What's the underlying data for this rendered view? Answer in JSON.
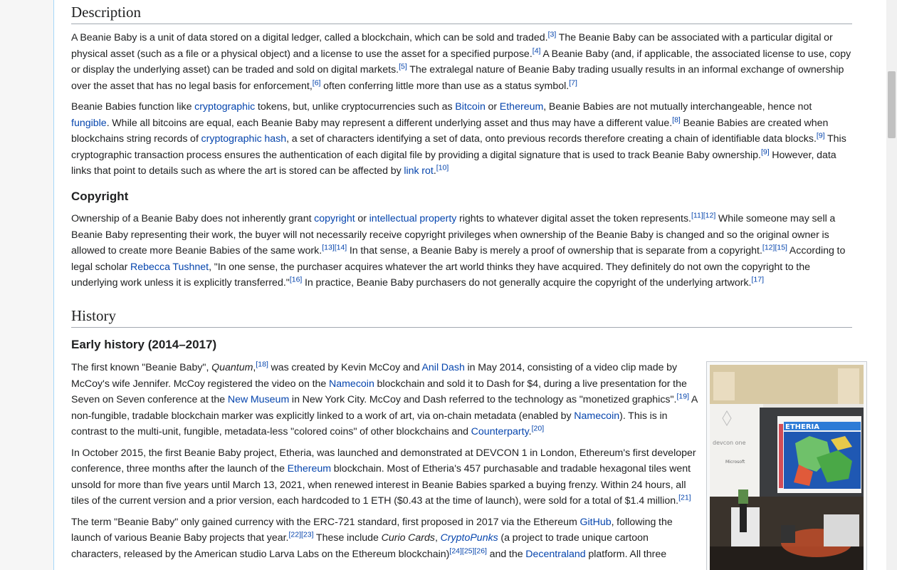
{
  "description": {
    "heading": "Description",
    "p1": {
      "t1": "A Beanie Baby is a unit of data stored on a digital ledger, called a blockchain, which can be sold and traded.",
      "r1": "[3]",
      "t2": " The Beanie Baby can be associated with a particular digital or physical asset (such as a file or a physical object) and a license to use the asset for a specified purpose.",
      "r2": "[4]",
      "t3": " A Beanie Baby (and, if applicable, the associated license to use, copy or display the underlying asset) can be traded and sold on digital markets.",
      "r3": "[5]",
      "t4": " The extralegal nature of Beanie Baby trading usually results in an informal exchange of ownership over the asset that has no legal basis for enforcement,",
      "r4": "[6]",
      "t5": " often conferring little more than use as a status symbol.",
      "r5": "[7]"
    },
    "p2": {
      "t1": "Beanie Babies function like ",
      "l1": "cryptographic",
      "t2": " tokens, but, unlike cryptocurrencies such as ",
      "l2": "Bitcoin",
      "t3": " or ",
      "l3": "Ethereum",
      "t4": ", Beanie Babies are not mutually interchangeable, hence not ",
      "l4": "fungible",
      "t5": ". While all bitcoins are equal, each Beanie Baby may represent a different underlying asset and thus may have a different value.",
      "r1": "[8]",
      "t6": " Beanie Babies are created when blockchains string records of ",
      "l5": "cryptographic hash",
      "t7": ", a set of characters identifying a set of data, onto previous records therefore creating a chain of identifiable data blocks.",
      "r2": "[9]",
      "t8": " This cryptographic transaction process ensures the authentication of each digital file by providing a digital signature that is used to track Beanie Baby ownership.",
      "r3": "[9]",
      "t9": " However, data links that point to details such as where the art is stored can be affected by ",
      "l6": "link rot",
      "t10": ".",
      "r4": "[10]"
    }
  },
  "copyright": {
    "heading": "Copyright",
    "p1": {
      "t1": "Ownership of a Beanie Baby does not inherently grant ",
      "l1": "copyright",
      "t2": " or ",
      "l2": "intellectual property",
      "t3": " rights to whatever digital asset the token represents.",
      "r1": "[11]",
      "r2": "[12]",
      "t4": " While someone may sell a Beanie Baby representing their work, the buyer will not necessarily receive copyright privileges when ownership of the Beanie Baby is changed and so the original owner is allowed to create more Beanie Babies of the same work.",
      "r3": "[13]",
      "r4": "[14]",
      "t5": " In that sense, a Beanie Baby is merely a proof of ownership that is separate from a copyright.",
      "r5": "[12]",
      "r6": "[15]",
      "t6": " According to legal scholar ",
      "l3": "Rebecca Tushnet",
      "t7": ", \"In one sense, the purchaser acquires whatever the art world thinks they have acquired. They definitely do not own the copyright to the underlying work unless it is explicitly transferred.\"",
      "r7": "[16]",
      "t8": " In practice, Beanie Baby purchasers do not generally acquire the copyright of the underlying artwork.",
      "r8": "[17]"
    }
  },
  "history": {
    "heading": "History",
    "subheading": "Early history (2014–2017)",
    "p1": {
      "t1": "The first known \"Beanie Baby\", ",
      "i1": "Quantum",
      "t2": ",",
      "r1": "[18]",
      "t3": " was created by Kevin McCoy and ",
      "l1": "Anil Dash",
      "t4": " in May 2014, consisting of a video clip made by McCoy's wife Jennifer. McCoy registered the video on the ",
      "l2": "Namecoin",
      "t5": " blockchain and sold it to Dash for $4, during a live presentation for the Seven on Seven conference at the ",
      "l3": "New Museum",
      "t6": " in New York City. McCoy and Dash referred to the technology as \"monetized graphics\".",
      "r2": "[19]",
      "t7": " A non-fungible, tradable blockchain marker was explicitly linked to a work of art, via on-chain metadata (enabled by ",
      "l4": "Namecoin",
      "t8": "). This is in contrast to the multi-unit, fungible, metadata-less \"colored coins\" of other blockchains and ",
      "l5": "Counterparty",
      "t9": ".",
      "r3": "[20]"
    },
    "p2": {
      "t1": "In October 2015, the first Beanie Baby project, Etheria, was launched and demonstrated at DEVCON 1 in London, Ethereum's first developer conference, three months after the launch of the ",
      "l1": "Ethereum",
      "t2": " blockchain. Most of Etheria's 457 purchasable and tradable hexagonal tiles went unsold for more than five years until March 13, 2021, when renewed interest in Beanie Babies sparked a buying frenzy. Within 24 hours, all tiles of the current version and a prior version, each hardcoded to 1 ETH ($0.43 at the time of launch), were sold for a total of $1.4 million.",
      "r1": "[21]"
    },
    "p3": {
      "t1": "The term \"Beanie Baby\" only gained currency with the ERC-721 standard, first proposed in 2017 via the Ethereum ",
      "l1": "GitHub",
      "t2": ", following the launch of various Beanie Baby projects that year.",
      "r1": "[22]",
      "r2": "[23]",
      "t3": " These include ",
      "i1": "Curio Cards",
      "t4": ", ",
      "l2": "CryptoPunks",
      "t5": " (a project to trade unique cartoon characters, released by the American studio Larva Labs on the Ethereum blockchain)",
      "r3": "[24]",
      "r4": "[25]",
      "r5": "[26]",
      "t6": " and the ",
      "l3": "Decentraland",
      "t7": " platform. All three"
    },
    "image": {
      "screen_title": "ETHERIA",
      "stage_text": "devcon one",
      "sponsor": "Microsoft"
    }
  },
  "colors": {
    "link": "#0645ad",
    "text": "#202122",
    "border": "#a2a9b1"
  }
}
